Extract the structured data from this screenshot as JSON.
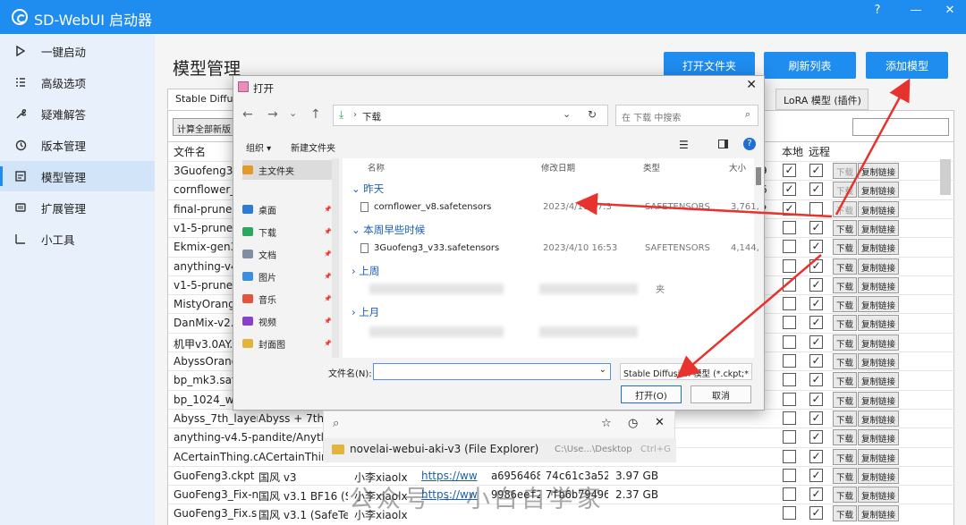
{
  "app": {
    "title": "SD-WebUI 启动器",
    "help": "?",
    "minimize": "—",
    "close": "✕"
  },
  "sidebar": {
    "items": [
      {
        "label": "一键启动",
        "icon": "play-icon"
      },
      {
        "label": "高级选项",
        "icon": "list-icon"
      },
      {
        "label": "疑难解答",
        "icon": "wrench-icon"
      },
      {
        "label": "版本管理",
        "icon": "history-icon"
      },
      {
        "label": "模型管理",
        "icon": "model-icon"
      },
      {
        "label": "扩展管理",
        "icon": "extension-icon"
      },
      {
        "label": "小工具",
        "icon": "tool-icon"
      }
    ]
  },
  "page": {
    "title": "模型管理",
    "btn_open_folder": "打开文件夹",
    "btn_refresh": "刷新列表",
    "btn_add_model": "添加模型"
  },
  "tabs": [
    {
      "label": "Stable Diffus"
    },
    {
      "label": "LoRA 模型 (插件)"
    }
  ],
  "toolbar": {
    "calc_label": "计算全部新版"
  },
  "table": {
    "headers": {
      "name": "文件名",
      "local": "本地",
      "remote": "远程"
    },
    "download": "下载",
    "copy_link": "复制链接",
    "rows": [
      {
        "name": "3Guofeng3_v",
        "tail": "9",
        "local": true,
        "remote": true
      },
      {
        "name": "cornflower_v",
        "tail": "6",
        "local": true,
        "remote": true
      },
      {
        "name": "final-prune.c",
        "tail": "2",
        "local": true,
        "remote": false
      },
      {
        "name": "v1-5-pruned",
        "tail": "",
        "local": false,
        "remote": true
      },
      {
        "name": "Ekmix-gen3.",
        "tail": "",
        "local": false,
        "remote": true
      },
      {
        "name": "anything-v4.",
        "tail": "",
        "local": false,
        "remote": true
      },
      {
        "name": "v1-5-pruned",
        "tail": "",
        "local": false,
        "remote": true
      },
      {
        "name": "MistyOrange",
        "tail": "",
        "local": false,
        "remote": true
      },
      {
        "name": "DanMix-v2.1",
        "tail": "",
        "local": false,
        "remote": true
      },
      {
        "name": "机甲v3.0AY.s",
        "tail": "",
        "local": false,
        "remote": true
      },
      {
        "name": "AbyssOrange",
        "tail": "",
        "local": false,
        "remote": true
      },
      {
        "name": "bp_mk3.safe",
        "tail": "",
        "local": false,
        "remote": true
      },
      {
        "name": "bp_1024_wit",
        "tail": "",
        "local": false,
        "remote": true
      },
      {
        "name": "Abyss_7th_layer.ck",
        "desc": "Abyss + 7th",
        "local": false,
        "remote": true
      },
      {
        "name": "anything-v4.5-pruı",
        "desc": "andite/Anytl",
        "local": false,
        "remote": true
      },
      {
        "name": "ACertainThing.ckpt",
        "desc": "ACertainThin",
        "local": false,
        "remote": true
      },
      {
        "name": "GuoFeng3.ckpt",
        "desc": "国风 v3",
        "author": "小李xiaolxl",
        "link": "https://ww",
        "hash1": "a6956468",
        "hash2": "74c61c3a52",
        "size": "3.97 GB",
        "local": false,
        "remote": true
      },
      {
        "name": "GuoFeng3_Fix-noı",
        "desc": "国风 v3.1 BF16 (Sa",
        "author": "小李xiaolxl",
        "link": "https://ww",
        "hash1": "9986eef2",
        "hash2": "7fb6b79496",
        "size": "2.37 GB",
        "local": false,
        "remote": true
      },
      {
        "name": "GuoFeng3_Fix.safe",
        "desc": "国风 v3.1 (SafeTen",
        "author": "小李xiaolxl",
        "link": "",
        "hash1": "",
        "hash2": "",
        "size": "",
        "local": false,
        "remote": true
      }
    ]
  },
  "dialog": {
    "title": "打开",
    "breadcrumb": "下载",
    "search_placeholder": "在 下载 中搜索",
    "toolbar": {
      "organize": "组织 ▾",
      "new_folder": "新建文件夹"
    },
    "left_items": [
      {
        "label": "主文件夹",
        "color": "#e39a2b"
      },
      {
        "label": "桌面",
        "color": "#2c7bd6"
      },
      {
        "label": "下载",
        "color": "#2aa860"
      },
      {
        "label": "文档",
        "color": "#7f8ea3"
      },
      {
        "label": "图片",
        "color": "#3b8ee0"
      },
      {
        "label": "音乐",
        "color": "#e2553a"
      },
      {
        "label": "视频",
        "color": "#8a3fc9"
      },
      {
        "label": "封面图",
        "color": "#e3b43a"
      }
    ],
    "columns": {
      "name": "名称",
      "modified": "修改日期",
      "type": "类型",
      "size": "大小"
    },
    "groups": {
      "yesterday": "昨天",
      "early_week": "本周早些时候",
      "last_week": "上周",
      "last_month": "上月"
    },
    "files": [
      {
        "name": "cornflower_v8.safetensors",
        "date": "2023/4/11 17:3",
        "type": "SAFETENSORS",
        "size": "3,761,"
      },
      {
        "name": "3Guofeng3_v33.safetensors",
        "date": "2023/4/10 16:53",
        "type": "SAFETENSORS",
        "size": "4,144,"
      }
    ],
    "blurred_suffix": "夹",
    "filename_label": "文件名(N):",
    "filter": "Stable Diffusion 模型 (*.ckpt;*",
    "open_btn": "打开(O)",
    "cancel_btn": "取消"
  },
  "flyout": {
    "item": "novelai-webui-aki-v3 (File Explorer)",
    "path": "C:\\Use...\\Desktop",
    "shortcut": "Ctrl+G"
  },
  "watermark": "公众号 · 小白自学家"
}
